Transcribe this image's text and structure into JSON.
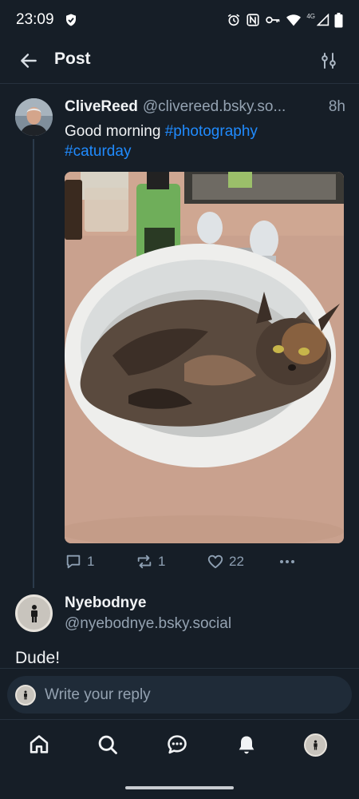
{
  "status_bar": {
    "time": "23:09",
    "network": "4G"
  },
  "header": {
    "title": "Post"
  },
  "post": {
    "author": "CliveReed",
    "handle": "@clivereed.bsky.so...",
    "time": "8h",
    "text_plain": "Good morning ",
    "hashtag1": "#photography",
    "hashtag2": "#caturday",
    "actions": {
      "replies": "1",
      "reposts": "1",
      "likes": "22"
    }
  },
  "reply": {
    "author": "Nyebodnye",
    "handle": "@nyebodnye.bsky.social",
    "text": "Dude!"
  },
  "composer": {
    "placeholder": "Write your reply"
  },
  "colors": {
    "accent": "#208bfe",
    "background": "#161e27",
    "muted": "#94a2b1"
  }
}
